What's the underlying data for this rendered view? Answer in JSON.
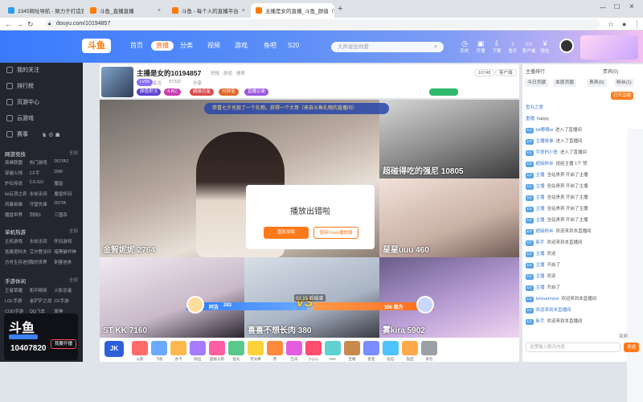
{
  "browser": {
    "tabs": [
      {
        "title": "2345网址导航 - 致力于打造百年品牌",
        "fav": "#2b9bf0"
      },
      {
        "title": "斗鱼_直播直播",
        "fav": "#ff7a00"
      },
      {
        "title": "斗鱼 - 每个人的直播平台",
        "fav": "#ff7a00"
      },
      {
        "title": "主播是女的直播_斗鱼_颜值（慢萌）直播",
        "fav": "#ff7a00"
      }
    ],
    "new_tab": "+",
    "url": "douyu.com/10194857"
  },
  "header": {
    "logo": "斗鱼",
    "nav": [
      "首页",
      "直播",
      "分类",
      "视频",
      "游戏",
      "鱼吧",
      "S20"
    ],
    "nav_active": "直播",
    "search_placeholder": "大声说出你爱",
    "icons": [
      "历史",
      "开播",
      "下载",
      "鱼乐",
      "客户端",
      "钱包"
    ]
  },
  "sidebar": {
    "items": [
      "我的关注",
      "排行榜",
      "页游中心",
      "云游戏",
      "赛事"
    ],
    "sections": [
      {
        "title": "网游竞技",
        "more": "全部",
        "games": [
          "英雄联盟",
          "热门游戏",
          "DOTA2",
          "穿越火线",
          "CF手",
          "DNF",
          "炉石传说",
          "CS:GO",
          "魔兽",
          "lol云顶之弈",
          "永劫无间",
          "魔兽怀旧",
          "风暴英雄",
          "守望先锋",
          "DOTA",
          "魔兽世界",
          "剑网3",
          "三国杀"
        ]
      },
      {
        "title": "单机热游",
        "more": "全部",
        "games": [
          "主机游戏",
          "永劫无间",
          "怀旧游戏",
          "逃离塔科夫",
          "艾尔登法环",
          "暗黑破坏神",
          "方舟生存进化",
          "我的世界",
          "刺客信条"
        ]
      },
      {
        "title": "手游休闲",
        "more": "全部",
        "games": [
          "王者荣耀",
          "和平精英",
          "火影忍者",
          "LOL手游",
          "金铲铲之战",
          "CF手游",
          "COD手游",
          "QQ飞车",
          "原神"
        ]
      }
    ],
    "ad_logo": "斗鱼",
    "ad_room": "10407820",
    "ad_button": "我要开播"
  },
  "room": {
    "title": "主播是女的10194857",
    "report": "举报",
    "category": "颜值 · 慢萌",
    "level": "LV55",
    "badges": [
      "颜值担当",
      "4.8亿",
      "超级巨星",
      "分钟宝",
      "直播记录"
    ],
    "followers_label": "关注",
    "hot": "97232",
    "share": "分享",
    "right_btn": "10748",
    "client_btn": "客户端"
  },
  "video": {
    "marquee": "恭喜七夕兑现了一个礼物，获得一个大哥（来自斗鱼礼物的直播间）",
    "cells": [
      {
        "name": "金智妮妮 2764"
      },
      {
        "name": "超碰得吃的强尼 10805"
      },
      {
        "name": "星星uuu 460"
      },
      {
        "name": "ST KK 7160"
      },
      {
        "name": "喜喜不想长肉 380"
      },
      {
        "name": "雾kira 5902"
      }
    ],
    "error_title": "播放出错啦",
    "error_retry": "重新加载",
    "error_flash": "使用Flash播放器",
    "pk_left_name": "阿吉",
    "pk_left_score": "283",
    "pk_right_name": "306 我方",
    "pk_timer": "01:15 后结束",
    "pk_vs": "VS",
    "lamb_left": "#4a9cff",
    "lamb_right": "#ff8a3c"
  },
  "giftbar": {
    "first_label": "JK",
    "gifts": [
      "火箭",
      "飞机",
      "办卡",
      "粉丝",
      "超级火箭",
      "鱼丸",
      "荧光棒",
      "赞",
      "告白",
      "小心心",
      "520",
      "宝箱",
      "星星",
      "钻石",
      "饭团",
      "背包"
    ]
  },
  "rpanel": {
    "top": [
      "主播排行",
      "贵宾(0)"
    ],
    "tabs": [
      "今日贡献",
      "本周贡献",
      "贵宾(0)",
      "粉丝(1)"
    ],
    "msgs": [
      {
        "lv": "",
        "user": "鱼丸之爱",
        "text": ""
      },
      {
        "lv": "",
        "user": "重播",
        "text": "happy"
      },
      {
        "lv": "LV",
        "user": "bb嘟嘟ai",
        "text": "进入了直播间"
      },
      {
        "lv": "LV",
        "user": "主播是谁",
        "text": "进入了直播间"
      },
      {
        "lv": "LV",
        "user": "可爱的小鱼",
        "text": "进入了直播间"
      },
      {
        "lv": "LV",
        "user": "超级粉丝",
        "text": "送给主播 1个 赞"
      },
      {
        "lv": "LV",
        "user": "主播",
        "text": "全站贵宾 开启了主播"
      },
      {
        "lv": "LV",
        "user": "主播",
        "text": "全站贵宾 开启了主播"
      },
      {
        "lv": "LV",
        "user": "主播",
        "text": "全站贵宾 开启了主播"
      },
      {
        "lv": "LV",
        "user": "主播",
        "text": "全站贵宾 开启了主播"
      },
      {
        "lv": "LV",
        "user": "主播",
        "text": "全站贵宾 开启了主播"
      },
      {
        "lv": "LV",
        "user": "超级粉丝",
        "text": "欢迎来到本直播间"
      },
      {
        "lv": "LV",
        "user": "新手",
        "text": "欢迎来到本直播间"
      },
      {
        "lv": "LV",
        "user": "主播",
        "text": "欢迎"
      },
      {
        "lv": "LV",
        "user": "主播",
        "text": "开启了"
      },
      {
        "lv": "LV",
        "user": "主播",
        "text": "欢迎"
      },
      {
        "lv": "LV",
        "user": "主播",
        "text": "开启了"
      },
      {
        "lv": "LV",
        "user": "Isheartmeel",
        "text": "欢迎来到本直播间"
      },
      {
        "lv": "LV",
        "user": "欢迎来到本直播间",
        "text": ""
      },
      {
        "lv": "LV",
        "user": "新手",
        "text": "欢迎来到本直播间"
      }
    ],
    "open_btn": "打开直播",
    "input_placeholder": "这里输入聊天内容",
    "send": "发送",
    "lock": "锁屏"
  }
}
